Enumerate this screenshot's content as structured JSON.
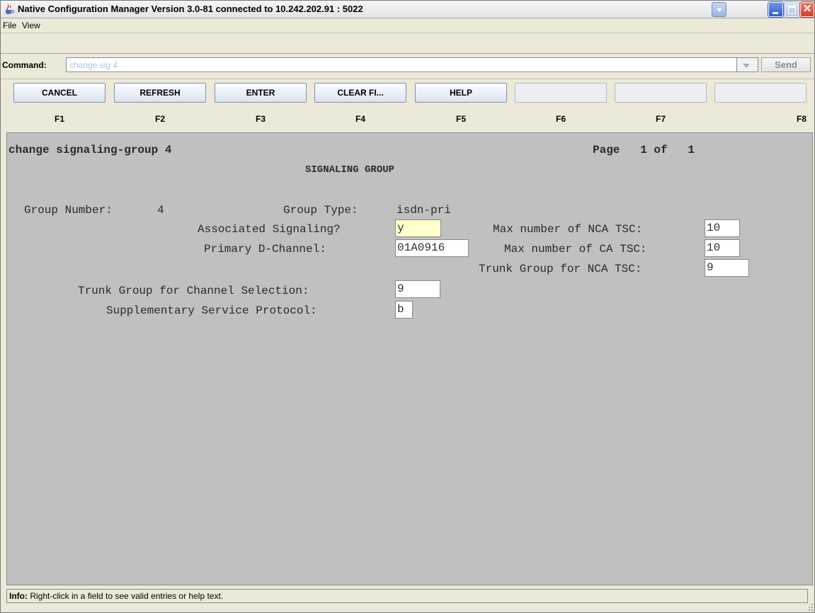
{
  "window": {
    "title": "Native Configuration Manager Version 3.0-81 connected to 10.242.202.91 : 5022",
    "icon": "java-cup-icon"
  },
  "menu": [
    "File",
    "View"
  ],
  "command": {
    "label": "Command:",
    "value": "change sig 4",
    "send_label": "Send"
  },
  "fkeys": [
    {
      "label": "CANCEL",
      "key": "F1"
    },
    {
      "label": "REFRESH",
      "key": "F2"
    },
    {
      "label": "ENTER",
      "key": "F3"
    },
    {
      "label": "CLEAR FI...",
      "key": "F4"
    },
    {
      "label": "HELP",
      "key": "F5"
    },
    {
      "label": "",
      "key": "F6"
    },
    {
      "label": "",
      "key": "F7"
    },
    {
      "label": "",
      "key": "F8"
    }
  ],
  "form": {
    "command_line": "change signaling-group 4",
    "page": "Page   1 of   1",
    "heading": "SIGNALING GROUP",
    "group_number_label": "Group Number:",
    "group_number": "4",
    "group_type_label": "Group Type:",
    "group_type": "isdn-pri",
    "associated_signaling_label": "Associated Signaling?",
    "associated_signaling": "y",
    "primary_dchannel_label": "Primary D-Channel:",
    "primary_dchannel": "01A0916",
    "max_nca_tsc_label": "Max number of NCA TSC:",
    "max_nca_tsc": "10",
    "max_ca_tsc_label": "Max number of CA TSC:",
    "max_ca_tsc": "10",
    "trunk_nca_tsc_label": "Trunk Group for NCA TSC:",
    "trunk_nca_tsc": "9",
    "trunk_channel_label": "Trunk Group for Channel Selection:",
    "trunk_channel": "9",
    "supp_protocol_label": "Supplementary Service Protocol:",
    "supp_protocol": "b"
  },
  "info": {
    "label": "Info:",
    "text": " Right-click in a field to see valid entries or help text."
  }
}
